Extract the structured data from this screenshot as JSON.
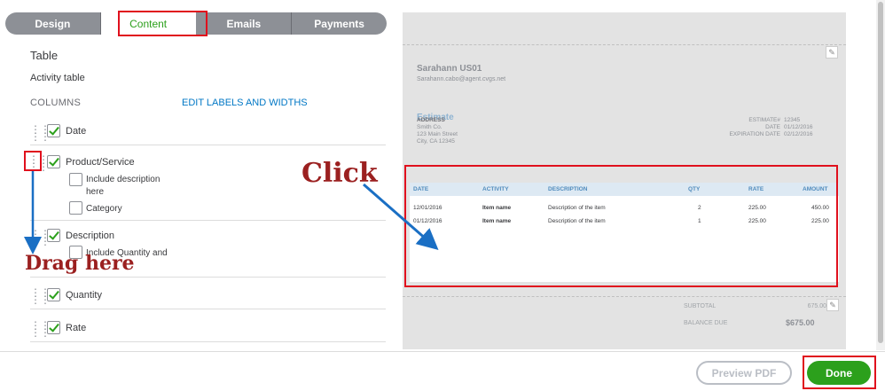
{
  "tabs": [
    "Design",
    "Content",
    "Emails",
    "Payments"
  ],
  "active_tab": "Content",
  "left": {
    "section_title": "Table",
    "subtitle": "Activity table",
    "columns_label": "COLUMNS",
    "edit_link": "EDIT LABELS AND WIDTHS",
    "columns": [
      {
        "label": "Date",
        "checked": true
      },
      {
        "label": "Product/Service",
        "checked": true
      },
      {
        "label": "Description",
        "checked": true
      },
      {
        "label": "Quantity",
        "checked": true
      },
      {
        "label": "Rate",
        "checked": true
      }
    ],
    "sub_options": {
      "include_description": "Include description here",
      "category": "Category",
      "include_quantity": "Include Quantity and"
    }
  },
  "annotations": {
    "click": "Click",
    "drag": "Drag here"
  },
  "preview": {
    "company_name": "Sarahann US01",
    "company_email": "Sarahann.cabo@agent.cvgs.net",
    "doc_title": "Estimate",
    "address_label": "ADDRESS",
    "address_lines": [
      "Smith Co.",
      "123 Main Street",
      "City, CA 12345"
    ],
    "meta": [
      {
        "label": "ESTIMATE#",
        "value": "12345"
      },
      {
        "label": "DATE",
        "value": "01/12/2016"
      },
      {
        "label": "EXPIRATION DATE",
        "value": "02/12/2016"
      }
    ],
    "table_headers": [
      "DATE",
      "ACTIVITY",
      "DESCRIPTION",
      "QTY",
      "RATE",
      "AMOUNT"
    ],
    "table_rows": [
      [
        "12/01/2016",
        "Item name",
        "Description of the item",
        "2",
        "225.00",
        "450.00"
      ],
      [
        "01/12/2016",
        "Item name",
        "Description of the item",
        "1",
        "225.00",
        "225.00"
      ]
    ],
    "subtotal_label": "SUBTOTAL",
    "subtotal_value": "675.00",
    "balance_label": "BALANCE DUE",
    "balance_value": "$675.00"
  },
  "footer": {
    "preview_pdf": "Preview PDF",
    "done": "Done"
  },
  "colors": {
    "accent_green": "#2ca01c",
    "link_blue": "#0077c5",
    "highlight_red": "#e0101d",
    "annotation_red": "#9b2020",
    "arrow_blue": "#1a6fc4"
  },
  "icons": [
    "grip-icon",
    "checkbox-icon",
    "pencil-icon",
    "arrow-icon"
  ]
}
